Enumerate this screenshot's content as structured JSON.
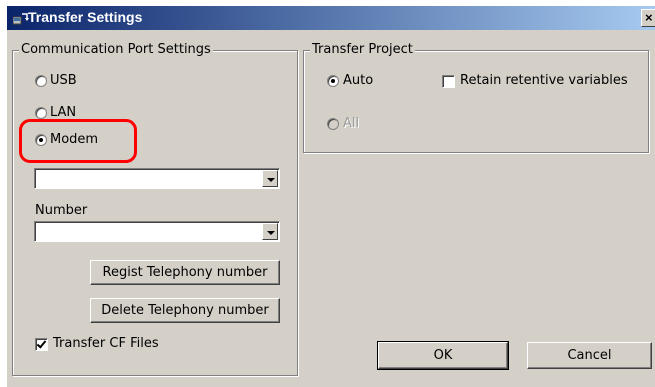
{
  "window": {
    "title": "Transfer Settings",
    "close_label": "×"
  },
  "communication": {
    "legend": "Communication Port Settings",
    "options": [
      {
        "label": "USB",
        "selected": false
      },
      {
        "label": "LAN",
        "selected": false
      },
      {
        "label": "Modem",
        "selected": true
      }
    ],
    "modem_combo_value": "",
    "number_label": "Number",
    "number_combo_value": "",
    "regist_button": "Regist Telephony number",
    "delete_button": "Delete Telephony number",
    "transfer_cf": {
      "label": "Transfer CF Files",
      "checked": true
    }
  },
  "project": {
    "legend": "Transfer Project",
    "auto": {
      "label": "Auto",
      "selected": true
    },
    "all": {
      "label": "All",
      "selected": false,
      "disabled": true
    },
    "retain": {
      "label": "Retain retentive variables",
      "checked": false
    }
  },
  "buttons": {
    "ok": "OK",
    "cancel": "Cancel"
  },
  "colors": {
    "dialog": "#d4d0c8",
    "title_start": "#0a246a",
    "title_end": "#a6caf0",
    "highlight": "#ff0000"
  },
  "icons": {
    "title": "transfer-settings-icon"
  }
}
